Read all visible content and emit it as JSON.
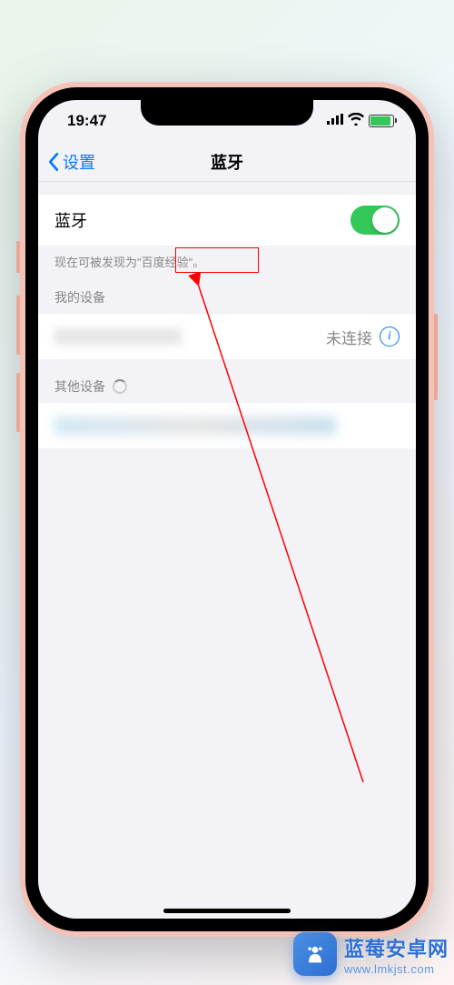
{
  "status": {
    "time": "19:47"
  },
  "nav": {
    "back_label": "设置",
    "title": "蓝牙"
  },
  "bluetooth": {
    "label": "蓝牙",
    "enabled": true,
    "discoverable_text": "现在可被发现为\"百度经验\"。"
  },
  "sections": {
    "my_devices": "我的设备",
    "other_devices": "其他设备"
  },
  "device": {
    "status": "未连接"
  },
  "watermark": {
    "title": "蓝莓安卓网",
    "url": "www.lmkjst.com"
  }
}
